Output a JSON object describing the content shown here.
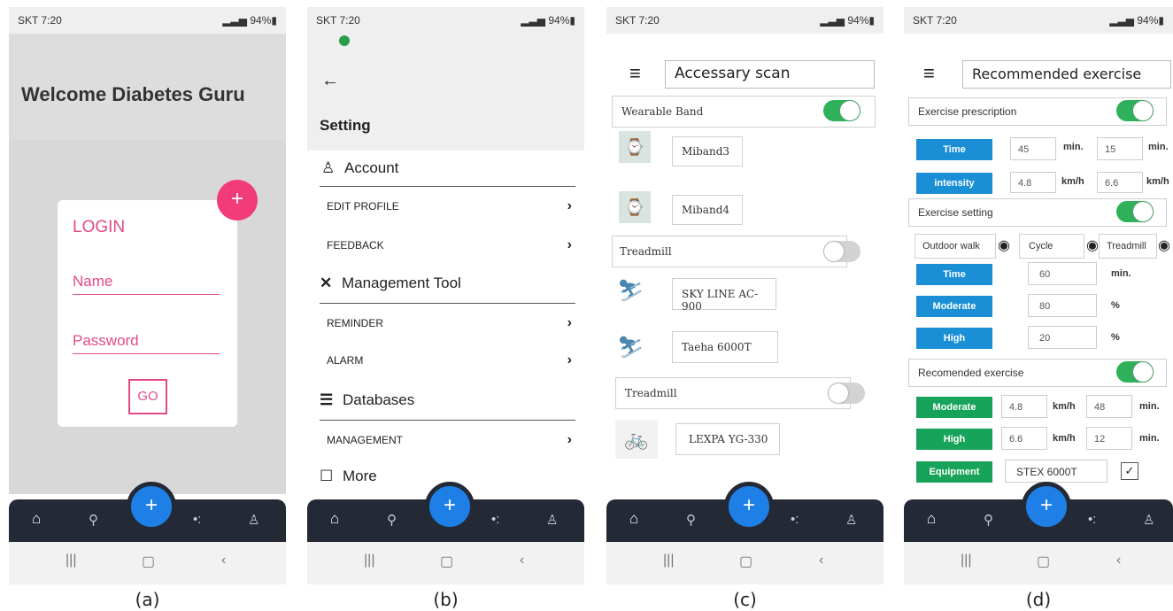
{
  "status": {
    "left": "SKT 7:20",
    "right": "94%"
  },
  "screen_a": {
    "title": "Welcome Diabetes Guru",
    "login_title": "LOGIN",
    "name_placeholder": "Name",
    "password_placeholder": "Password",
    "go_label": "GO",
    "caption": "(a)"
  },
  "screen_b": {
    "title": "Setting",
    "sections": [
      {
        "label": "Account"
      },
      {
        "label": "Management Tool"
      },
      {
        "label": "Databases"
      },
      {
        "label": "More"
      }
    ],
    "items": [
      "EDIT PROFILE",
      "FEEDBACK",
      "REMINDER",
      "ALARM",
      "MANAGEMENT"
    ],
    "caption": "(b)"
  },
  "screen_c": {
    "title": "Accessary scan",
    "wearable_label": "Wearable Band",
    "devices": [
      "Miband3",
      "Miband4"
    ],
    "treadmill_label": "Treadmill",
    "treadmills": [
      "SKY LINE AC-900",
      "Taeha 6000T"
    ],
    "treadmill_label_2": "Treadmill",
    "bike": "LEXPA YG-330",
    "caption": "(c)"
  },
  "screen_d": {
    "title": "Recommended exercise",
    "prescription_label": "Exercise prescription",
    "time_label": "Time",
    "time_values": [
      "45",
      "15"
    ],
    "min_unit": "min.",
    "intensity_label": "intensity",
    "intensity_values": [
      "4.8",
      "6.6"
    ],
    "kmh_unit": "km/h",
    "setting_label": "Exercise setting",
    "modes": [
      "Outdoor walk",
      "Cycle",
      "Treadmill"
    ],
    "setting_time_label": "Time",
    "setting_time_value": "60",
    "moderate_label": "Moderate",
    "moderate_value": "80",
    "high_label": "High",
    "high_value": "20",
    "percent_unit": "%",
    "recommended_label": "Recomended exercise",
    "rec_moderate_label": "Moderate",
    "rec_moderate_speed": "4.8",
    "rec_moderate_min": "48",
    "rec_high_label": "High",
    "rec_high_speed": "6.6",
    "rec_high_min": "12",
    "equipment_label": "Equipment",
    "equipment_value": "STEX 6000T",
    "equipment_checked": "✓",
    "caption": "(d)"
  },
  "nav_icons": [
    "home-icon",
    "search-icon",
    "add-icon",
    "dots-icon",
    "user-icon"
  ]
}
